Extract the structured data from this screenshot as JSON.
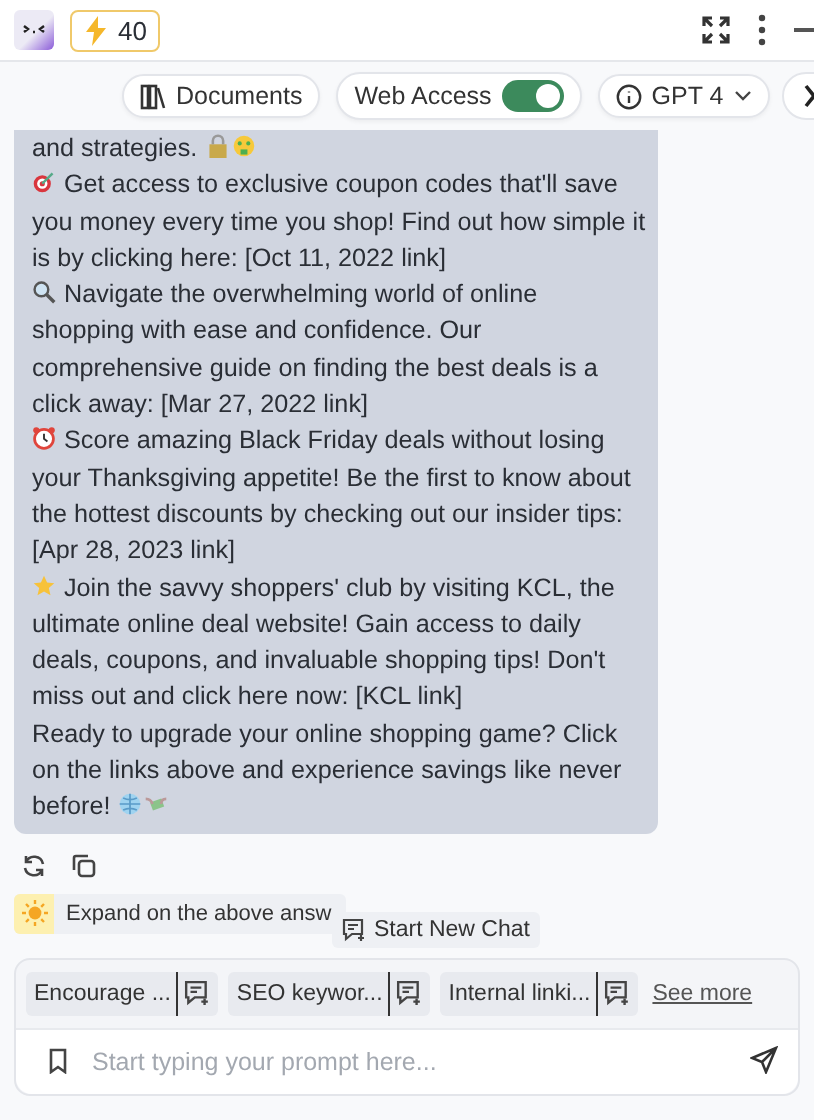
{
  "header": {
    "credits": "40"
  },
  "toolbar": {
    "documents": "Documents",
    "web_access": {
      "label": "Web Access",
      "on": true
    },
    "model": "GPT 4"
  },
  "message": {
    "paragraphs": [
      {
        "text": "and strategies.",
        "kind": "lock-money"
      },
      {
        "text": "Get access to exclusive coupon codes that'll save you money every time you shop! Find out how simple it is by clicking here: [Oct 11, 2022 link]",
        "kind": "target"
      },
      {
        "text": "Navigate the overwhelming world of online shopping with ease and confidence. Our comprehensive guide on finding the best deals is a click away: [Mar 27, 2022 link]",
        "kind": "magnifier"
      },
      {
        "text": "Score amazing Black Friday deals without losing your Thanksgiving appetite! Be the first to know about the hottest discounts by checking out our insider tips: [Apr 28, 2023 link]",
        "kind": "clock"
      },
      {
        "text": "Join the savvy shoppers' club by visiting KCL, the ultimate online deal website! Gain access to daily deals, coupons, and invaluable shopping tips! Don't miss out and click here now: [KCL link]",
        "kind": "star"
      },
      {
        "text": "Ready to upgrade your online shopping game? Click on the links above and experience savings like never before!",
        "kind": "globe-money"
      }
    ]
  },
  "suggestion": "Expand on the above answ",
  "tooltip": "Start New Chat",
  "prompts": [
    "Encourage ...",
    "SEO keywor...",
    "Internal linki..."
  ],
  "see_more": "See more",
  "input": {
    "placeholder": "Start typing your prompt here..."
  }
}
